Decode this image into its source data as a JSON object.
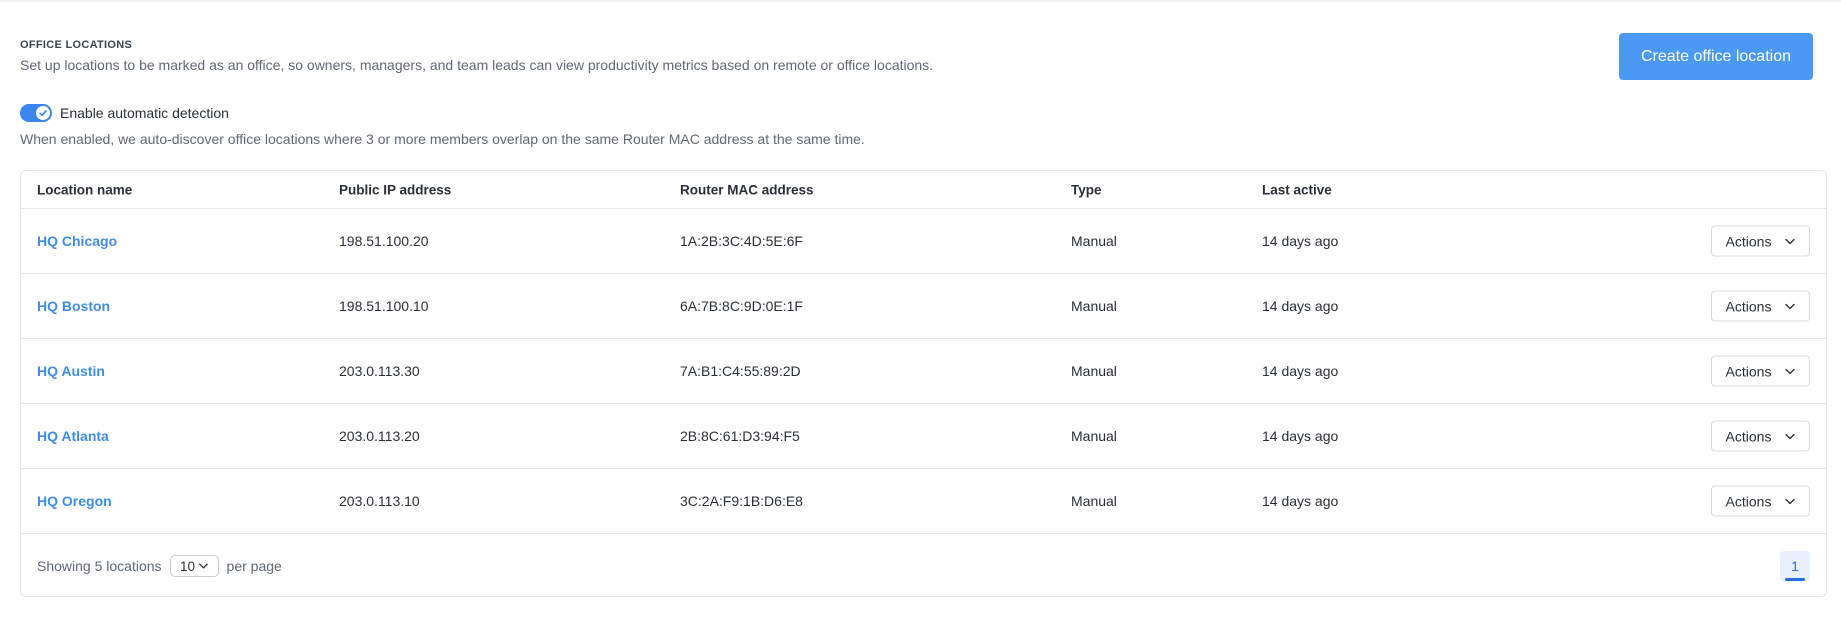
{
  "header": {
    "title": "OFFICE LOCATIONS",
    "description": "Set up locations to be marked as an office, so owners, managers, and team leads can view productivity metrics based on remote or office locations.",
    "create_button": "Create office location"
  },
  "detection": {
    "enabled": true,
    "label": "Enable automatic detection",
    "help": "When enabled, we auto-discover office locations where 3 or more members overlap on the same Router MAC address at the same time."
  },
  "table": {
    "columns": [
      "Location name",
      "Public IP address",
      "Router MAC address",
      "Type",
      "Last active"
    ],
    "rows": [
      {
        "name": "HQ Chicago",
        "ip": "198.51.100.20",
        "mac": "1A:2B:3C:4D:5E:6F",
        "type": "Manual",
        "last_active": "14 days ago",
        "action": "Actions"
      },
      {
        "name": "HQ Boston",
        "ip": "198.51.100.10",
        "mac": "6A:7B:8C:9D:0E:1F",
        "type": "Manual",
        "last_active": "14 days ago",
        "action": "Actions"
      },
      {
        "name": "HQ Austin",
        "ip": "203.0.113.30",
        "mac": "7A:B1:C4:55:89:2D",
        "type": "Manual",
        "last_active": "14 days ago",
        "action": "Actions"
      },
      {
        "name": "HQ Atlanta",
        "ip": "203.0.113.20",
        "mac": "2B:8C:61:D3:94:F5",
        "type": "Manual",
        "last_active": "14 days ago",
        "action": "Actions"
      },
      {
        "name": "HQ Oregon",
        "ip": "203.0.113.10",
        "mac": "3C:2A:F9:1B:D6:E8",
        "type": "Manual",
        "last_active": "14 days ago",
        "action": "Actions"
      }
    ]
  },
  "footer": {
    "showing": "Showing 5 locations",
    "per_page_value": "10",
    "per_page_label": "per page",
    "current_page": "1"
  },
  "colors": {
    "accent": "#4a9af4",
    "link": "#3f8de8",
    "toggle_on": "#3a86ef"
  }
}
